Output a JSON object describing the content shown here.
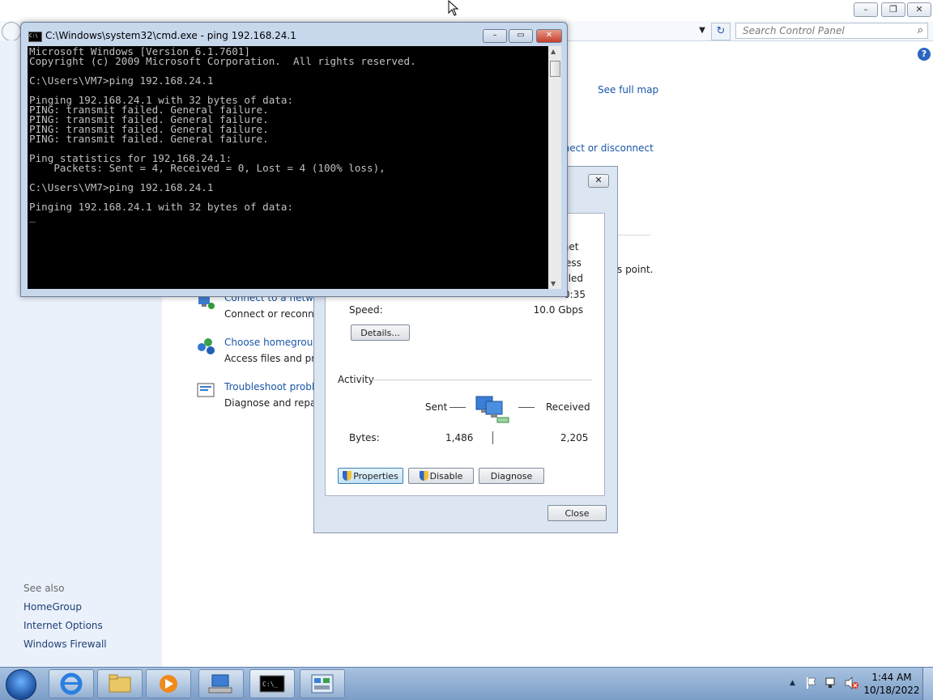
{
  "control_panel": {
    "search_placeholder": "Search Control Panel",
    "see_full_map": "See full map",
    "connect_disconnect_fragment": "nnect or disconnect",
    "access_point_fragment": "s point.",
    "tasks": [
      {
        "title": "Connect to a network",
        "desc": "Connect or reconnect"
      },
      {
        "title": "Choose homegroup",
        "desc": "Access files and print"
      },
      {
        "title": "Troubleshoot problem",
        "desc": "Diagnose and repair n"
      }
    ],
    "see_also": {
      "heading": "See also",
      "links": [
        "HomeGroup",
        "Internet Options",
        "Windows Firewall"
      ]
    }
  },
  "status_dialog": {
    "peek_values": [
      "rnet",
      "ess",
      "bled",
      "0:35"
    ],
    "speed_label": "Speed:",
    "speed_value": "10.0 Gbps",
    "details_button": "Details...",
    "activity_label": "Activity",
    "sent_label": "Sent",
    "received_label": "Received",
    "bytes_label": "Bytes:",
    "bytes_sent": "1,486",
    "bytes_received": "2,205",
    "properties_button": "Properties",
    "disable_button": "Disable",
    "diagnose_button": "Diagnose",
    "close_button": "Close"
  },
  "cmd": {
    "title": "C:\\Windows\\system32\\cmd.exe - ping  192.168.24.1",
    "lines": [
      "Microsoft Windows [Version 6.1.7601]",
      "Copyright (c) 2009 Microsoft Corporation.  All rights reserved.",
      "",
      "C:\\Users\\VM7>ping 192.168.24.1",
      "",
      "Pinging 192.168.24.1 with 32 bytes of data:",
      "PING: transmit failed. General failure.",
      "PING: transmit failed. General failure.",
      "PING: transmit failed. General failure.",
      "PING: transmit failed. General failure.",
      "",
      "Ping statistics for 192.168.24.1:",
      "    Packets: Sent = 4, Received = 0, Lost = 4 (100% loss),",
      "",
      "C:\\Users\\VM7>ping 192.168.24.1",
      "",
      "Pinging 192.168.24.1 with 32 bytes of data:",
      "_"
    ]
  },
  "taskbar": {
    "time": "1:44 AM",
    "date": "10/18/2022"
  }
}
